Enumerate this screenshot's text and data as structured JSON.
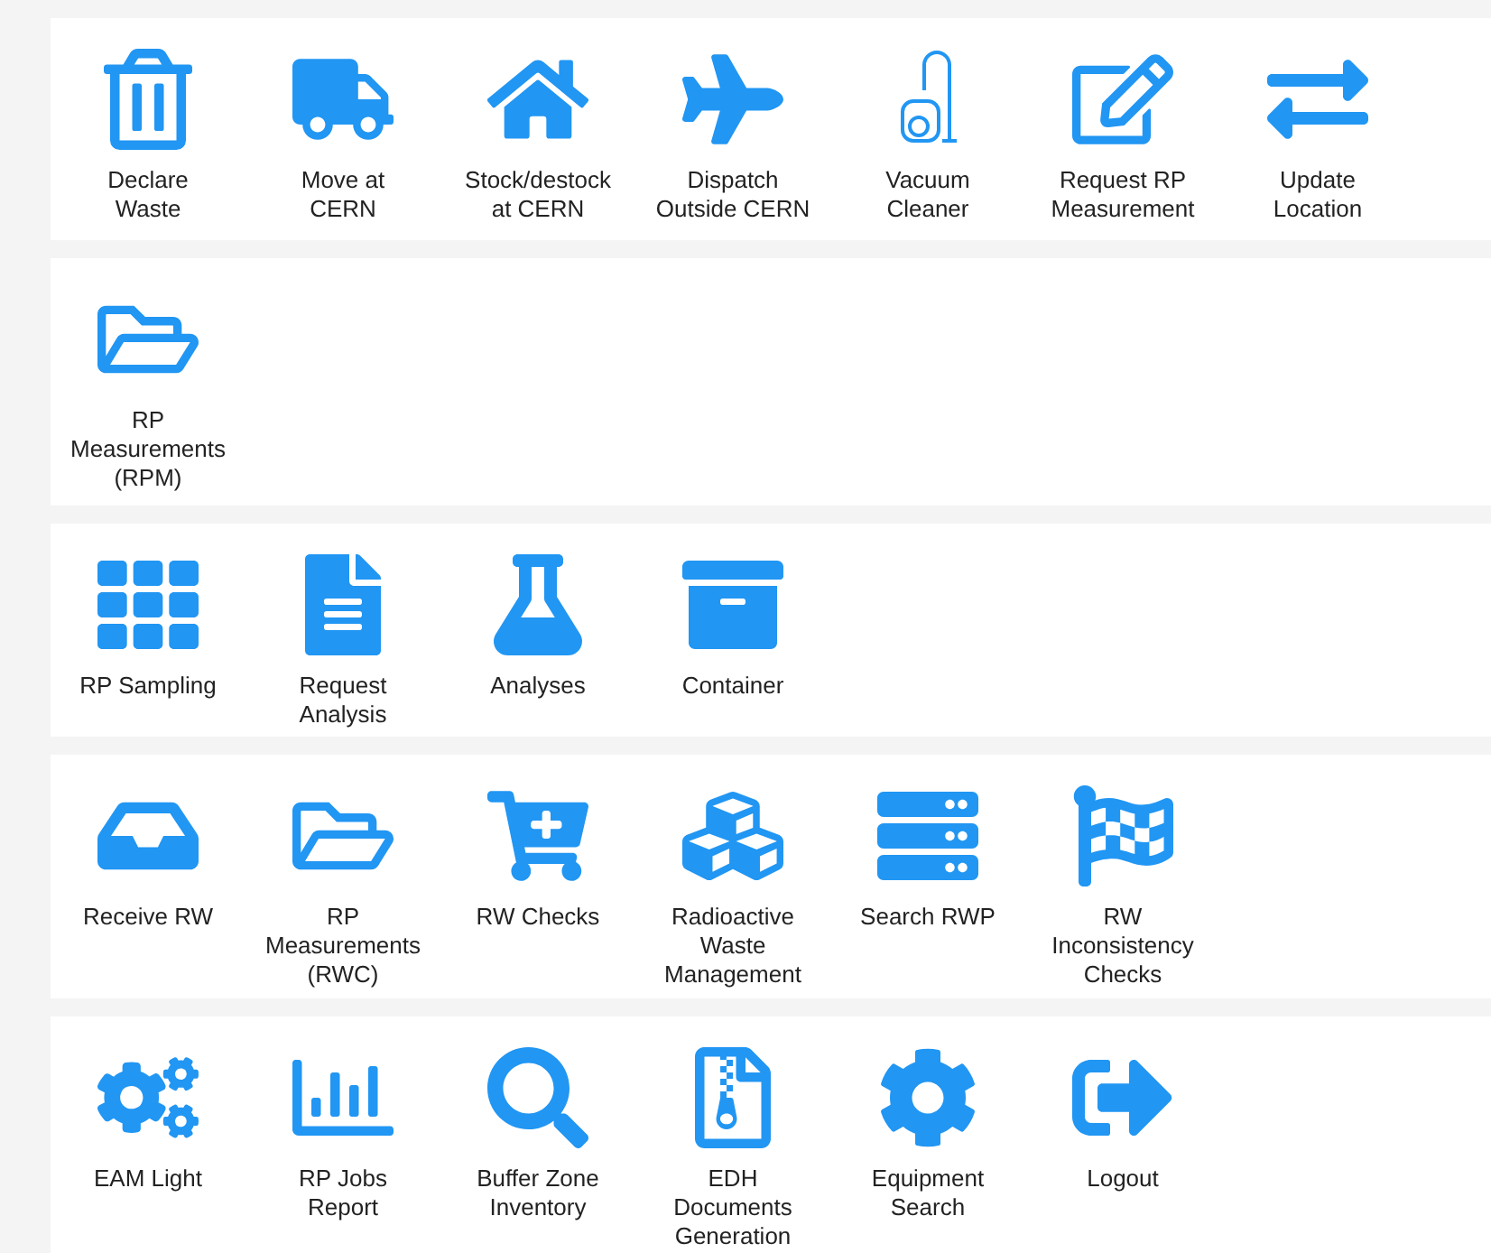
{
  "sections": [
    {
      "items": [
        {
          "label": "Declare\nWaste"
        },
        {
          "label": "Move at\nCERN"
        },
        {
          "label": "Stock/destock\nat CERN"
        },
        {
          "label": "Dispatch\nOutside CERN"
        },
        {
          "label": "Vacuum\nCleaner"
        },
        {
          "label": "Request RP\nMeasurement"
        },
        {
          "label": "Update\nLocation"
        }
      ]
    },
    {
      "items": [
        {
          "label": "RP\nMeasurements\n(RPM)"
        }
      ]
    },
    {
      "items": [
        {
          "label": "RP Sampling"
        },
        {
          "label": "Request\nAnalysis"
        },
        {
          "label": "Analyses"
        },
        {
          "label": "Container"
        }
      ]
    },
    {
      "items": [
        {
          "label": "Receive RW"
        },
        {
          "label": "RP\nMeasurements\n(RWC)"
        },
        {
          "label": "RW Checks"
        },
        {
          "label": "Radioactive\nWaste\nManagement"
        },
        {
          "label": "Search RWP"
        },
        {
          "label": "RW\nInconsistency\nChecks"
        }
      ]
    },
    {
      "items": [
        {
          "label": "EAM Light"
        },
        {
          "label": "RP Jobs\nReport"
        },
        {
          "label": "Buffer Zone\nInventory"
        },
        {
          "label": "EDH\nDocuments\nGeneration"
        },
        {
          "label": "Equipment\nSearch"
        },
        {
          "label": "Logout"
        }
      ]
    }
  ]
}
